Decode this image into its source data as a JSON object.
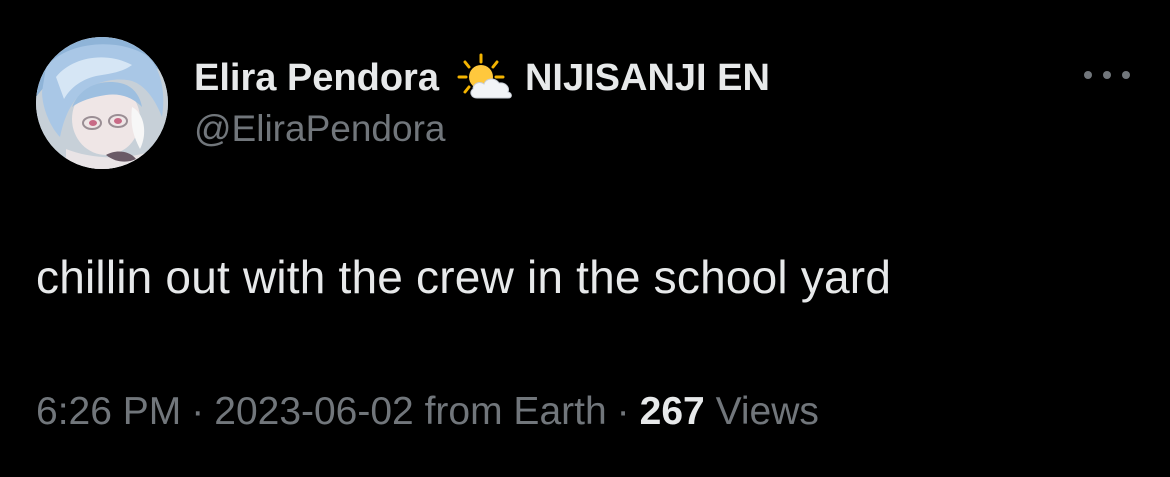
{
  "tweet": {
    "author": {
      "display_name": "Elira Pendora",
      "affiliation_icon": "sun-behind-cloud-icon",
      "affiliation": "NIJISANJI EN",
      "handle": "@EliraPendora",
      "avatar": "avatar-image"
    },
    "more_icon": "more-options-icon",
    "text": "chillin out with the crew in the school yard",
    "meta": {
      "time": "6:26 PM",
      "separator": "·",
      "date": "2023-06-02",
      "source": "from Earth",
      "views_count": "267",
      "views_label": "Views"
    }
  },
  "colors": {
    "background": "#000000",
    "primary_text": "#e7e9ea",
    "secondary_text": "#71767b"
  }
}
